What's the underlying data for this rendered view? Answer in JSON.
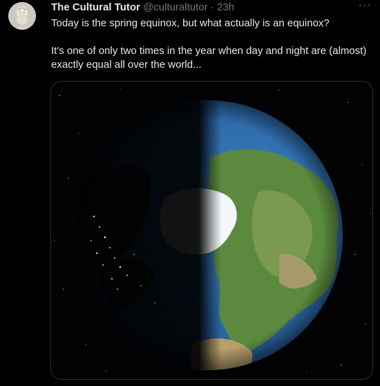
{
  "tweet": {
    "author": {
      "display_name": "The Cultural Tutor",
      "handle": "@culturaltutor",
      "avatar_icon": "bust-statue-avatar"
    },
    "separator": "·",
    "timestamp": "23h",
    "more_icon": "ellipsis-icon",
    "text_lines": [
      "Today is the spring equinox, but what actually is an equinox?",
      "It's one of only two times in the year when day and night are (almost) exactly equal all over the world..."
    ],
    "media": {
      "kind": "image",
      "subject": "earth-from-above-half-day-half-night",
      "colors": {
        "space": "#000000",
        "ocean": "#2f6fb0",
        "land": "#4f7d3a",
        "ice": "#ffffff",
        "city_lights": "#f4d27a"
      }
    }
  }
}
